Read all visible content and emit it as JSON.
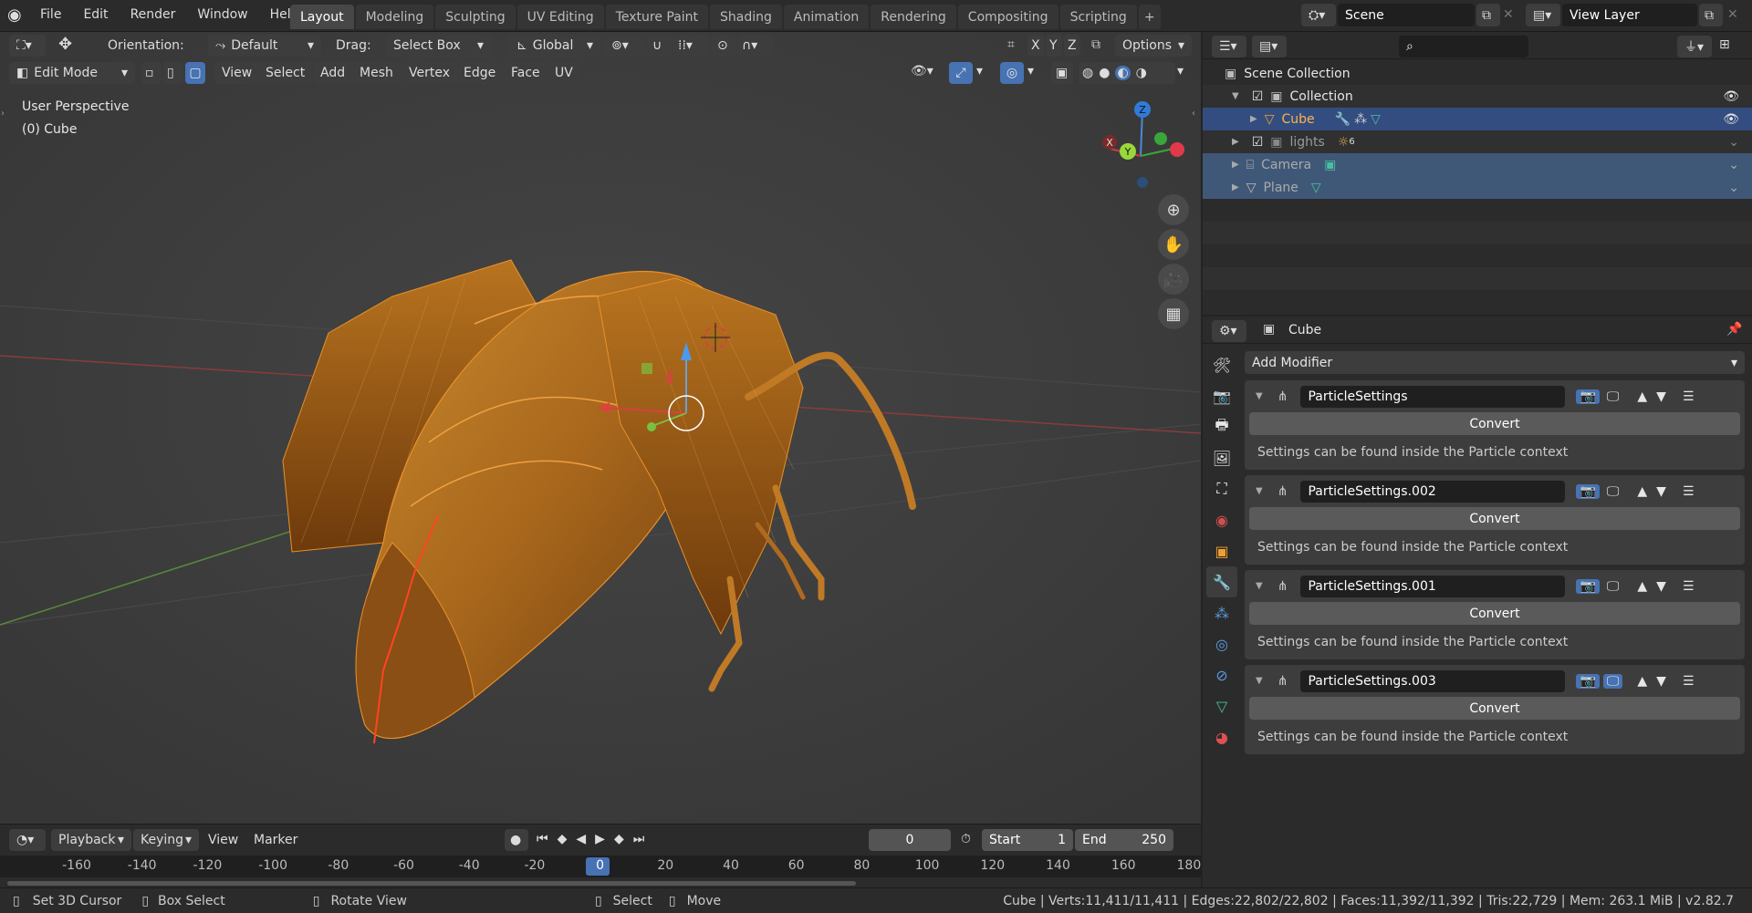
{
  "topbar": {
    "menus": [
      "File",
      "Edit",
      "Render",
      "Window",
      "Help"
    ],
    "workspaces": [
      "Layout",
      "Modeling",
      "Sculpting",
      "UV Editing",
      "Texture Paint",
      "Shading",
      "Animation",
      "Rendering",
      "Compositing",
      "Scripting"
    ],
    "active_workspace": "Layout",
    "scene_name": "Scene",
    "view_layer": "View Layer"
  },
  "viewport": {
    "orientation_label": "Orientation:",
    "orientation_value": "Default",
    "drag_label": "Drag:",
    "drag_value": "Select Box",
    "transform_space": "Global",
    "axes": [
      "X",
      "Y",
      "Z"
    ],
    "options_label": "Options",
    "mode": "Edit Mode",
    "menus": [
      "View",
      "Select",
      "Add",
      "Mesh",
      "Vertex",
      "Edge",
      "Face",
      "UV"
    ],
    "overlay_line1": "User Perspective",
    "overlay_line2": "(0) Cube",
    "gizmo_axes": {
      "z": "Z",
      "y": "Y",
      "x": "X"
    }
  },
  "timeline": {
    "menus": [
      "Playback",
      "Keying",
      "View",
      "Marker"
    ],
    "current_frame": "0",
    "start_label": "Start",
    "start_value": "1",
    "end_label": "End",
    "end_value": "250",
    "ruler": [
      "-160",
      "-140",
      "-120",
      "-100",
      "-80",
      "-60",
      "-40",
      "-20",
      "0",
      "20",
      "40",
      "60",
      "80",
      "100",
      "120",
      "140",
      "160",
      "180"
    ]
  },
  "statusbar": {
    "hint1": "Set 3D Cursor",
    "hint2": "Box Select",
    "hint3": "Rotate View",
    "hint4": "Select",
    "hint5": "Move",
    "stats": "Cube | Verts:11,411/11,411 | Edges:22,802/22,802 | Faces:11,392/11,392 | Tris:22,729 | Mem: 263.1 MiB | v2.82.7"
  },
  "outliner": {
    "root": "Scene Collection",
    "items": [
      {
        "label": "Collection"
      },
      {
        "label": "Cube"
      },
      {
        "label": "lights",
        "badge": "6"
      },
      {
        "label": "Camera"
      },
      {
        "label": "Plane"
      }
    ]
  },
  "properties": {
    "object_name": "Cube",
    "add_modifier": "Add Modifier",
    "modifiers": [
      {
        "name": "ParticleSettings",
        "convert": "Convert",
        "note": "Settings can be found inside the Particle context"
      },
      {
        "name": "ParticleSettings.002",
        "convert": "Convert",
        "note": "Settings can be found inside the Particle context"
      },
      {
        "name": "ParticleSettings.001",
        "convert": "Convert",
        "note": "Settings can be found inside the Particle context"
      },
      {
        "name": "ParticleSettings.003",
        "convert": "Convert",
        "note": "Settings can be found inside the Particle context"
      }
    ]
  },
  "colors": {
    "accent_blue": "#4772b3",
    "selection_orange": "#e8912a",
    "outliner_selected": "#334d80"
  }
}
